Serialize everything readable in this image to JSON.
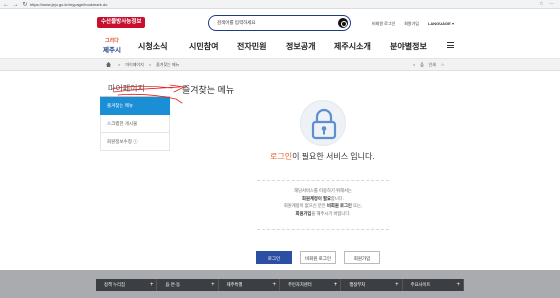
{
  "browser": {
    "nav_icons": "← → ↻",
    "url": "https://www.jeju.go.kr/mypage/bookmark.do",
    "tools": "☆ ⋯"
  },
  "header": {
    "badge": "수산물방사능정보",
    "search_placeholder": "검색어를 입력하세요",
    "utils": [
      "비회원 로그인",
      "회원가입",
      "LANGUAGE ▾"
    ]
  },
  "logo": {
    "line1": "그리다",
    "line2": "제주시"
  },
  "main_menu": [
    "시청소식",
    "시민참여",
    "전자민원",
    "정보공개",
    "제주시소개",
    "분야별정보"
  ],
  "breadcrumb": {
    "items": [
      "마이페이지",
      "즐겨찾는 메뉴"
    ],
    "sep": ">",
    "right": [
      "<",
      "⎙",
      "인쇄",
      "☆"
    ]
  },
  "sidebar": {
    "title": "마이페이지",
    "items": [
      {
        "label": "즐겨찾는 메뉴",
        "active": true
      },
      {
        "label": "스크랩한 게시물",
        "active": false
      },
      {
        "label": "회원정보수정 ⓘ",
        "active": false
      }
    ]
  },
  "content": {
    "page_title": "즐겨찾는 메뉴",
    "login_word": "로그인",
    "login_rest": "이 필요한 서비스 입니다.",
    "msg": {
      "l1": "해당서비스를 이용하기 위해서는",
      "l2": "회원계정이 필요",
      "l2_suffix": "합니다.",
      "l3_a": "회원계정이 없으신 분은 ",
      "l3_b": "비회원 로그인",
      "l3_c": " 또는,",
      "l4_a": "회원가입",
      "l4_b": "을 해주시기 바랍니다."
    },
    "buttons": [
      "로그인",
      "비회원 로그인",
      "회원가입"
    ]
  },
  "footer": {
    "items": [
      "정책 누리집",
      "읍·면·동",
      "제주특별",
      "주민자치센터",
      "행정부처",
      "주요사이트"
    ]
  },
  "colors": {
    "brand_red": "#c8102e",
    "brand_blue": "#1d3c87",
    "active_blue": "#1b8fd6",
    "accent_orange": "#e8622c",
    "annotation_red": "#e02020"
  }
}
